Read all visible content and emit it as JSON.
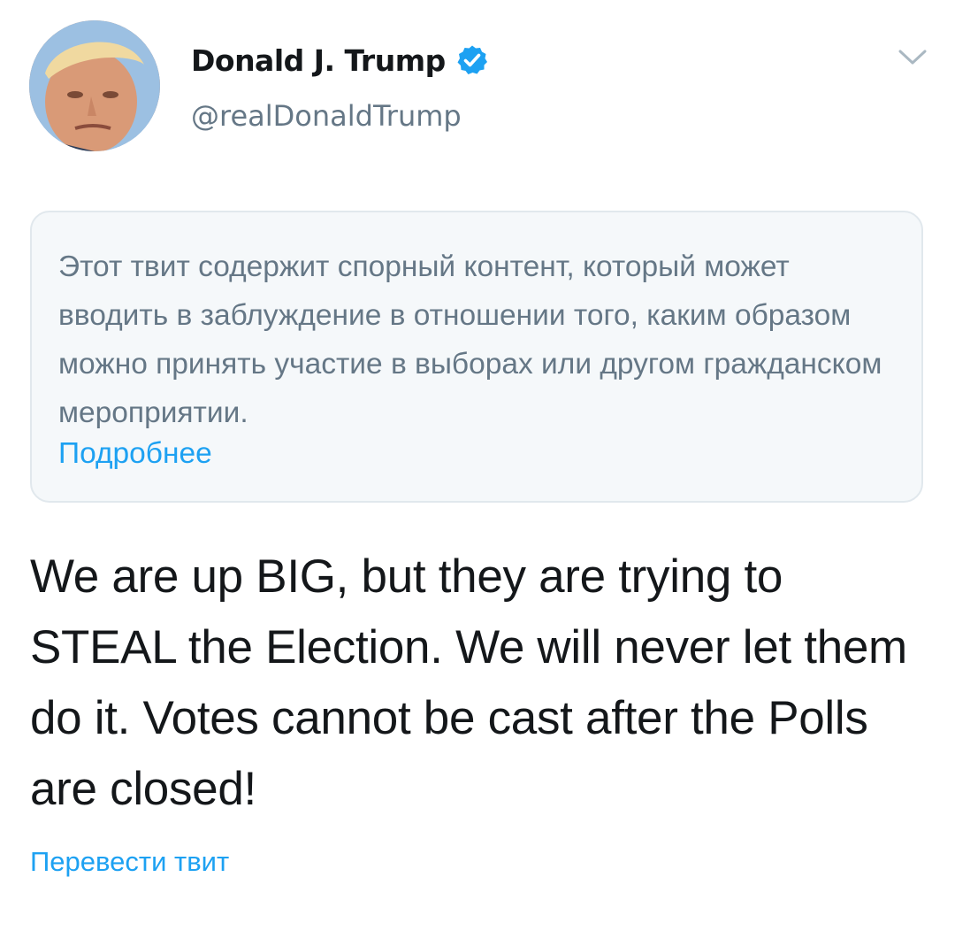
{
  "author": {
    "display_name": "Donald J. Trump",
    "handle": "@realDonaldTrump",
    "verified": true,
    "avatar_icon": "avatar-photo",
    "verified_icon": "verified-badge-icon",
    "menu_icon": "chevron-down-icon"
  },
  "notice": {
    "text": "Этот твит содержит спорный контент, который может вводить в заблуждение в отношении того, каким образом можно принять участие в выборах или другом гражданском мероприятии.",
    "link_label": "Подробнее"
  },
  "tweet": {
    "text": "We are up BIG, but they are trying to STEAL the Election. We will never let them do it. Votes cannot be cast after the Polls are closed!"
  },
  "actions": {
    "translate_label": "Перевести твит"
  },
  "colors": {
    "accent": "#1da1f2",
    "secondary_text": "#657786",
    "notice_background": "#f5f8fa",
    "notice_border": "#e1e8ed"
  }
}
